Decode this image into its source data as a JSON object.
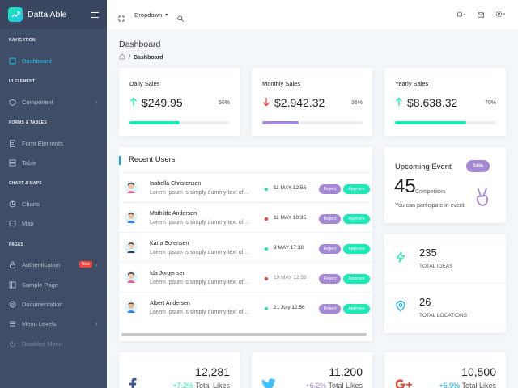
{
  "brand": {
    "name": "Datta Able"
  },
  "sidebar": {
    "captions": {
      "navigation": "NAVIGATION",
      "ui_element": "UI ELEMENT",
      "forms_tables": "FORMS & TABLES",
      "chart_maps": "CHART & MAPS",
      "pages": "PAGES"
    },
    "items": [
      {
        "label": "Dashboard"
      },
      {
        "label": "Component"
      },
      {
        "label": "Form Elements"
      },
      {
        "label": "Table"
      },
      {
        "label": "Charts"
      },
      {
        "label": "Map"
      },
      {
        "label": "Authentication",
        "badge": "New"
      },
      {
        "label": "Sample Page"
      },
      {
        "label": "Documentation"
      },
      {
        "label": "Menu Levels"
      },
      {
        "label": "Disabled Menu"
      }
    ]
  },
  "topbar": {
    "dropdown_label": "Dropdown"
  },
  "page": {
    "title": "Dashboard",
    "breadcrumb_current": "Dashboard"
  },
  "sales": [
    {
      "title": "Daily Sales",
      "amount": "$249.95",
      "percent": "50%",
      "progress": 50,
      "trend": "up",
      "color": "#1de9b6"
    },
    {
      "title": "Monthly Sales",
      "amount": "$2.942.32",
      "percent": "36%",
      "progress": 36,
      "trend": "down",
      "color": "#a389d4"
    },
    {
      "title": "Yearly Sales",
      "amount": "$8.638.32",
      "percent": "70%",
      "progress": 70,
      "trend": "up",
      "color": "#1de9b6"
    }
  ],
  "recent_users": {
    "title": "Recent Users",
    "reject_label": "Reject",
    "approve_label": "Approve",
    "rows": [
      {
        "name": "Isabella Christensen",
        "desc": "Lorem Ipsum is simply dummy text of…",
        "date": "11 MAY 12:56",
        "status": "green"
      },
      {
        "name": "Mathilde Andersen",
        "desc": "Lorem Ipsum is simply dummy text of…",
        "date": "11 MAY 10:35",
        "status": "red"
      },
      {
        "name": "Karla Sorensen",
        "desc": "Lorem Ipsum is simply dummy text of…",
        "date": "9 MAY 17:38",
        "status": "green"
      },
      {
        "name": "Ida Jorgensen",
        "desc": "Lorem Ipsum is simply dummy text of…",
        "date": "19 MAY 12:56",
        "status": "red"
      },
      {
        "name": "Albert Andersen",
        "desc": "Lorem Ipsum is simply dummy text of…",
        "date": "21 July 12:56",
        "status": "green"
      }
    ]
  },
  "event": {
    "title": "Upcoming Event",
    "badge": "34%",
    "count": "45",
    "count_label": "Competitors",
    "text": "You can participate in event"
  },
  "stats": [
    {
      "value": "235",
      "label": "TOTAL IDEAS",
      "icon": "bolt-icon"
    },
    {
      "value": "26",
      "label": "TOTAL LOCATIONS",
      "icon": "map-pin-icon"
    }
  ],
  "social": [
    {
      "network": "facebook",
      "value": "12,281",
      "delta": "+7.2%",
      "label": "Total Likes",
      "color": "#3b5998"
    },
    {
      "network": "twitter",
      "value": "11,200",
      "delta": "+6.2%",
      "label": "Total Likes",
      "color": "#42c0fb"
    },
    {
      "network": "google-plus",
      "value": "10,500",
      "delta": "+5.9%",
      "label": "Total Likes",
      "color": "#dd4b39"
    }
  ],
  "colors": {
    "sidebar": "#3f4d67",
    "accent": "#04a9f5",
    "teal": "#1de9b6",
    "purple": "#a389d4"
  }
}
